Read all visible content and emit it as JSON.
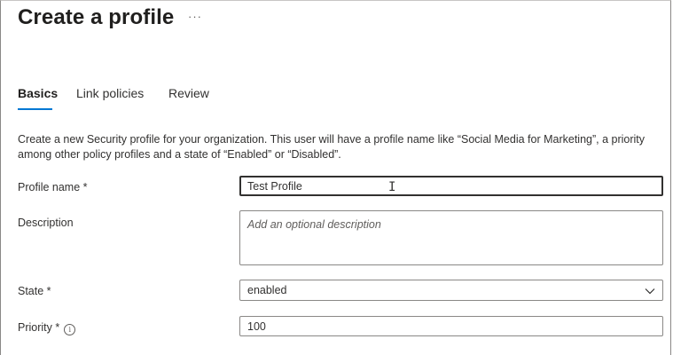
{
  "page": {
    "title": "Create a profile",
    "more_label": "···"
  },
  "tabs": [
    {
      "label": "Basics",
      "active": true
    },
    {
      "label": "Link policies",
      "active": false
    },
    {
      "label": "Review",
      "active": false
    }
  ],
  "description": "Create a new Security profile for your organization. This user will have a profile name like “Social Media for Marketing”, a priority among other policy profiles and a state of “Enabled” or “Disabled”.",
  "form": {
    "profile_name": {
      "label": "Profile name *",
      "value": "Test Profile"
    },
    "description": {
      "label": "Description",
      "placeholder": "Add an optional description"
    },
    "state": {
      "label": "State *",
      "value": "enabled"
    },
    "priority": {
      "label": "Priority *",
      "value": "100"
    }
  },
  "icons": {
    "info": "info-icon",
    "chevron": "chevron-down-icon",
    "cursor": "text-cursor-icon"
  },
  "colors": {
    "accent": "#0078d4",
    "border": "#8a8886",
    "text": "#323130"
  }
}
